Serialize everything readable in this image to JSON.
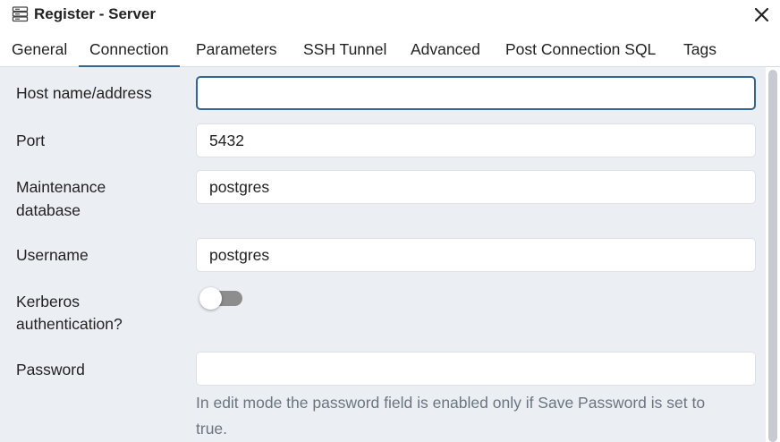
{
  "window": {
    "title": "Register - Server",
    "title_icon": "server-icon",
    "close_icon": "close-icon"
  },
  "tabs": [
    {
      "label": "General",
      "active": false
    },
    {
      "label": "Connection",
      "active": true
    },
    {
      "label": "Parameters",
      "active": false
    },
    {
      "label": "SSH Tunnel",
      "active": false
    },
    {
      "label": "Advanced",
      "active": false
    },
    {
      "label": "Post Connection SQL",
      "active": false
    },
    {
      "label": "Tags",
      "active": false
    }
  ],
  "form": {
    "host": {
      "label": "Host name/address",
      "value": ""
    },
    "port": {
      "label": "Port",
      "value": "5432"
    },
    "maintenance_db": {
      "label_line1": "Maintenance",
      "label_line2": "database",
      "value": "postgres"
    },
    "username": {
      "label": "Username",
      "value": "postgres"
    },
    "kerberos": {
      "label_line1": "Kerberos",
      "label_line2": "authentication?",
      "enabled": false
    },
    "password": {
      "label": "Password",
      "value": "",
      "help_line1": "In edit mode the password field is enabled only if Save Password is set to",
      "help_line2": "true."
    }
  },
  "colors": {
    "accent": "#326690",
    "content_bg": "#ebeef3",
    "toggle_off": "#8d8d8d",
    "help_text": "#6b7580"
  }
}
